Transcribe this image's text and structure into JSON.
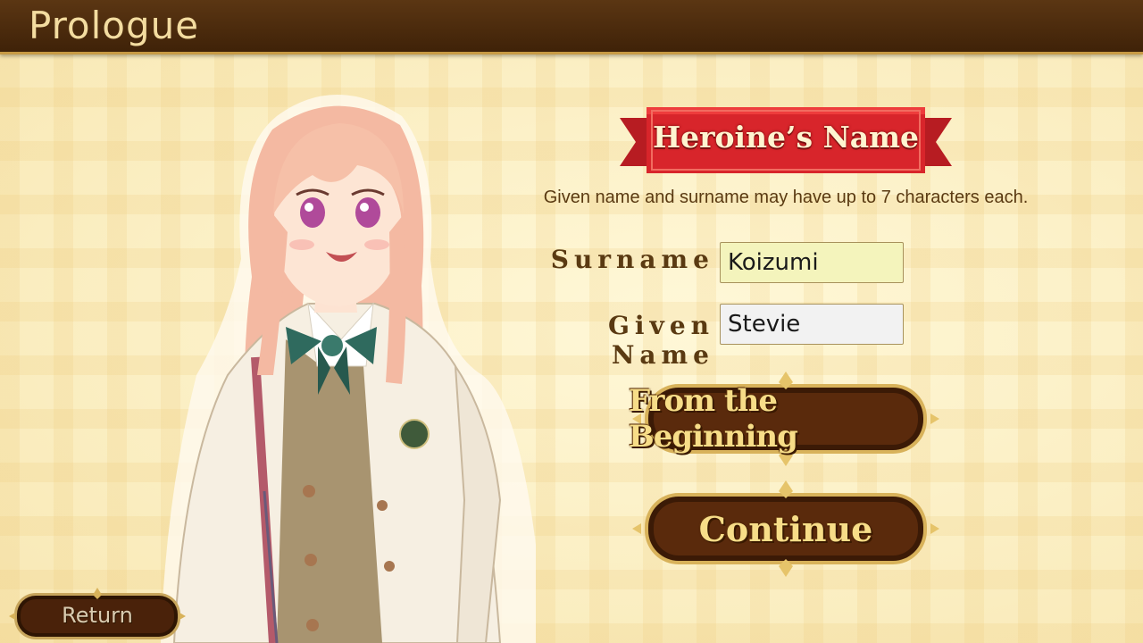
{
  "header": {
    "title": "Prologue"
  },
  "heroine": {
    "ribbon_title": "Heroine’s Name",
    "instructions": "Given name and surname may have up to 7 characters each."
  },
  "form": {
    "surname_label": "Surname",
    "surname_value": "Koizumi",
    "given_label": "Given Name",
    "given_value": "Stevie"
  },
  "buttons": {
    "from_beginning": "From the Beginning",
    "continue": "Continue",
    "return": "Return"
  },
  "colors": {
    "header_bar": "#4a2a0c",
    "header_text": "#f3dca0",
    "ribbon_red": "#d8252b",
    "button_brown": "#4a220a",
    "button_gold": "#d8b25a",
    "label_brown": "#5a3a12"
  }
}
